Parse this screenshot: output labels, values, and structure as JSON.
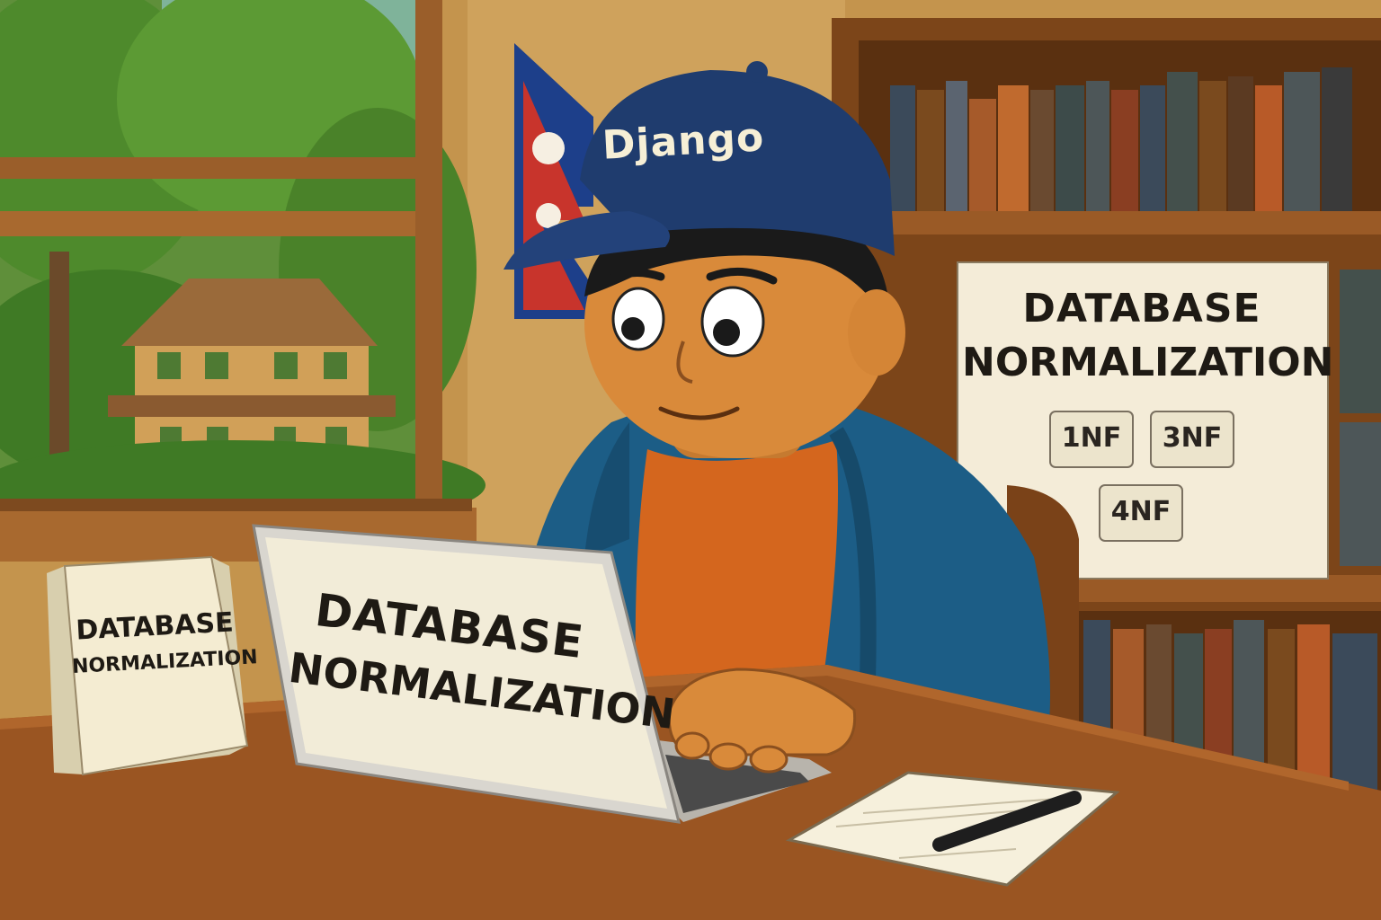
{
  "scene": {
    "cap_text": "Django",
    "poster": {
      "title_line1": "DATABASE",
      "title_line2": "NORMALIZATION",
      "forms": [
        "1NF",
        "3NF",
        "4NF"
      ]
    },
    "book": {
      "title_line1": "DATABASE",
      "title_line2": "NORMALIZATION"
    },
    "laptop": {
      "title_line1": "DATABASE",
      "title_line2": "NORMALIZATION"
    }
  },
  "colors": {
    "wall": "#c89a52",
    "wood": "#8a4f1f",
    "cap": "#1f3c6e",
    "hoodie": "#1c5d86",
    "shirt": "#d4661e",
    "skin": "#d98a3a",
    "flag_red": "#c8342c",
    "flag_blue": "#1d3f8a",
    "paper": "#f4ecd2"
  }
}
